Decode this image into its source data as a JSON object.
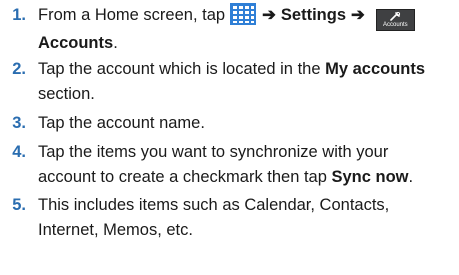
{
  "steps": [
    {
      "number": "1.",
      "pre": "From a Home screen, tap",
      "settings": "Settings",
      "accounts_icon_label": "Accounts",
      "accounts": "Accounts",
      "period": "."
    },
    {
      "number": "2.",
      "text_a": "Tap the account which is located in the ",
      "bold": "My accounts",
      "text_b": "section."
    },
    {
      "number": "3.",
      "text": "Tap the account name."
    },
    {
      "number": "4.",
      "line1": "Tap the items you want to synchronize with your",
      "line2_pre": "account to create a checkmark then tap ",
      "bold": "Sync now",
      "line2_post": "."
    },
    {
      "number": "5.",
      "line1": "This includes items such as Calendar, Contacts,",
      "line2": "Internet, Memos, etc."
    }
  ],
  "icons": {
    "apps": "apps-grid-icon",
    "accounts": "accounts-icon",
    "arrow": "right-arrow-icon"
  },
  "colors": {
    "step_number": "#2a6db0",
    "apps_icon": "#2f7fd6"
  }
}
